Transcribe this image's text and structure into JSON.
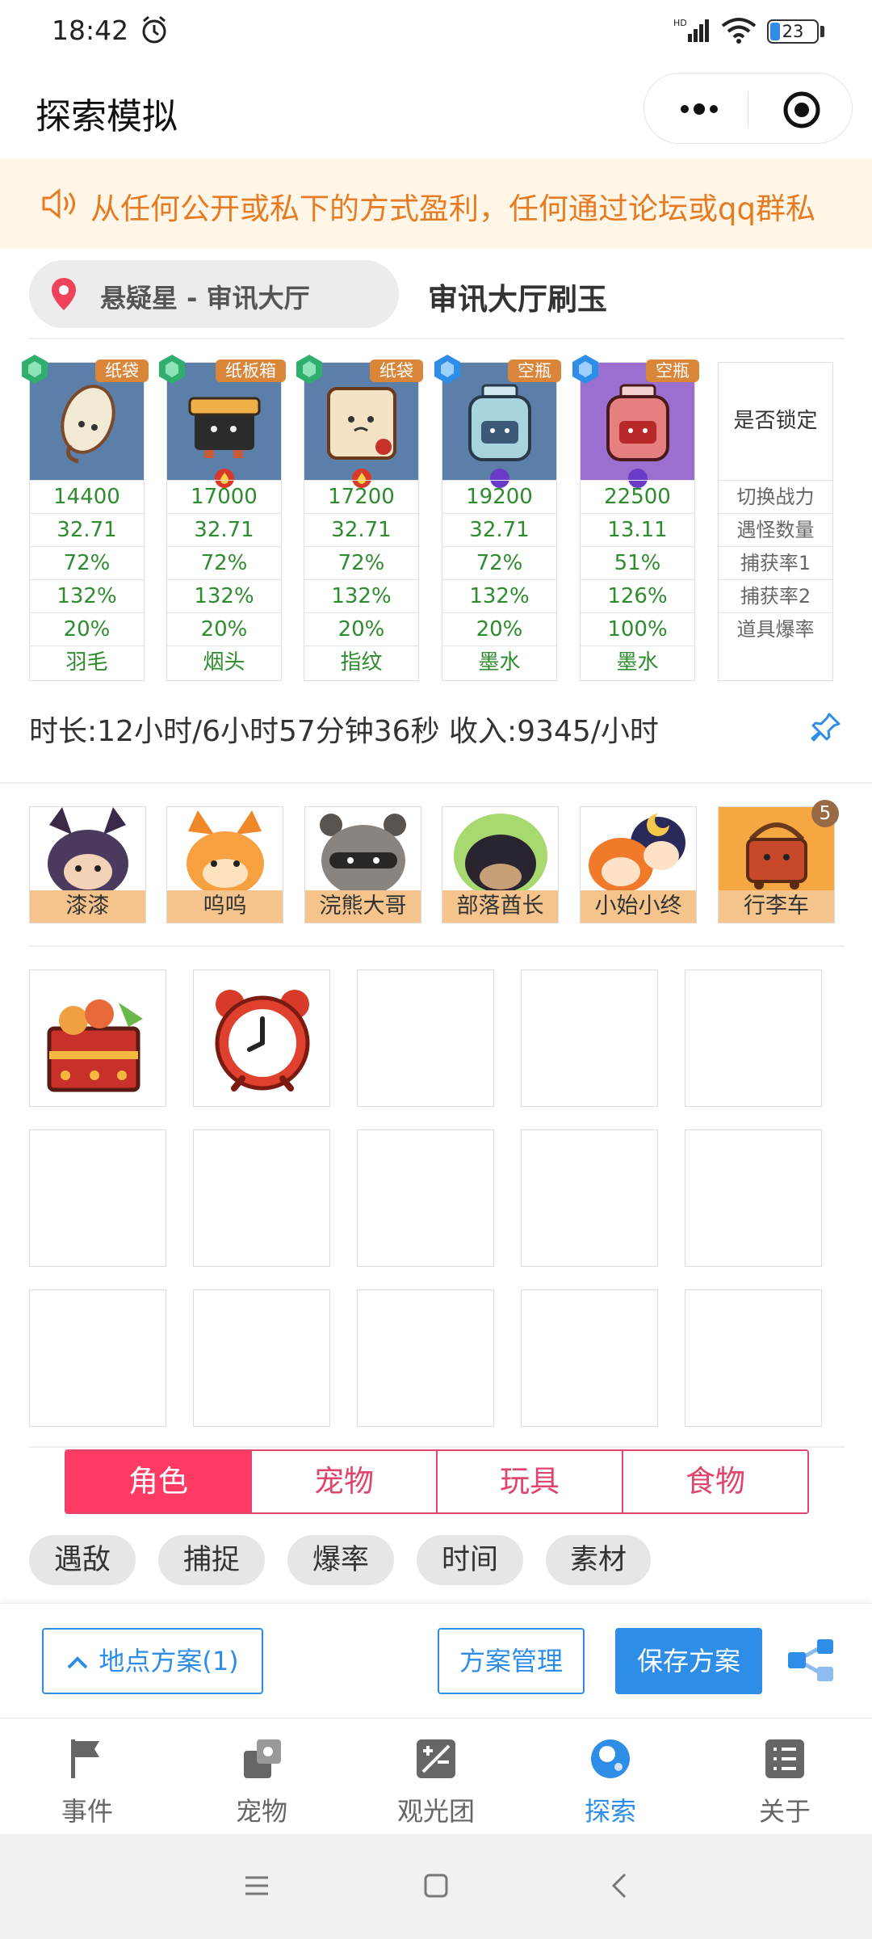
{
  "status": {
    "time": "18:42",
    "battery": "23",
    "network": "HD"
  },
  "nav": {
    "title": "探索模拟"
  },
  "notice": {
    "text": "从任何公开或私下的方式盈利，任何通过论坛或qq群私"
  },
  "location": {
    "name": "悬疑星 - 审讯大厅",
    "plan_title": "审讯大厅刷玉"
  },
  "cards": [
    {
      "tag": "纸袋",
      "values": [
        "14400",
        "32.71",
        "72%",
        "132%",
        "20%",
        "羽毛"
      ]
    },
    {
      "tag": "纸板箱",
      "values": [
        "17000",
        "32.71",
        "72%",
        "132%",
        "20%",
        "烟头"
      ]
    },
    {
      "tag": "纸袋",
      "values": [
        "17200",
        "32.71",
        "72%",
        "132%",
        "20%",
        "指纹"
      ]
    },
    {
      "tag": "空瓶",
      "values": [
        "19200",
        "32.71",
        "72%",
        "132%",
        "20%",
        "墨水"
      ]
    },
    {
      "tag": "空瓶",
      "values": [
        "22500",
        "13.11",
        "51%",
        "126%",
        "100%",
        "墨水"
      ]
    }
  ],
  "labels": {
    "lock": "是否锁定",
    "rows": [
      "切换战力",
      "遇怪数量",
      "捕获率1",
      "捕获率2",
      "道具爆率"
    ]
  },
  "summary": {
    "text": "时长:12小时/6小时57分钟36秒 收入:9345/小时"
  },
  "characters": [
    "漆漆",
    "呜呜",
    "浣熊大哥",
    "部落酋长",
    "小始小终",
    "行李车"
  ],
  "character_badge": "5",
  "tabs": [
    "角色",
    "宠物",
    "玩具",
    "食物"
  ],
  "chips": [
    "遇敌",
    "捕捉",
    "爆率",
    "时间",
    "素材"
  ],
  "actions": {
    "location_plan": "地点方案(1)",
    "manage": "方案管理",
    "save": "保存方案"
  },
  "tabbar": [
    "事件",
    "宠物",
    "观光团",
    "探索",
    "关于"
  ],
  "colors": {
    "accent_blue": "#2e8de6",
    "accent_pink": "#ff3b63",
    "notice_orange": "#e67b22",
    "value_green": "#2e8b2e"
  }
}
